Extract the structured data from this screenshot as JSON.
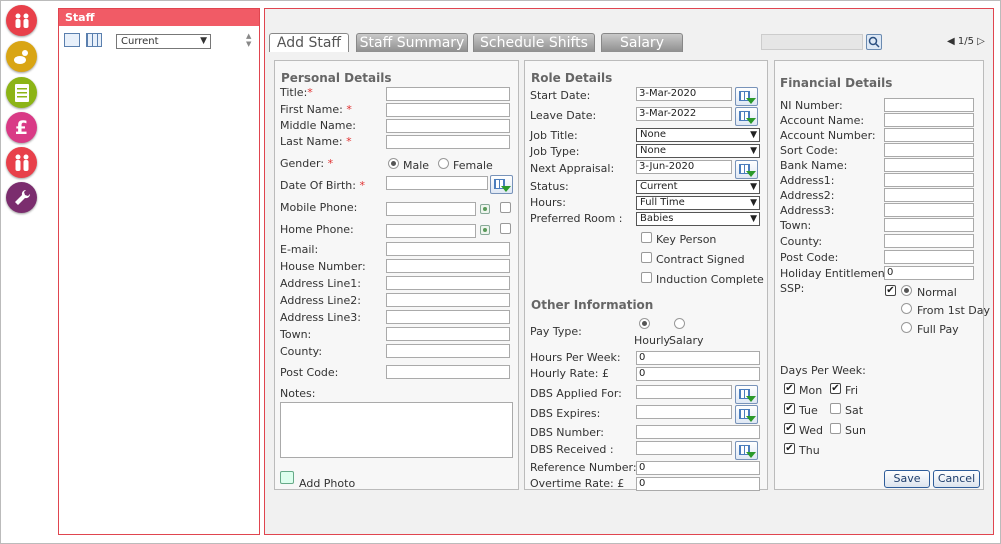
{
  "nav": {
    "icons": [
      "staff-group-icon",
      "children-icon",
      "register-icon",
      "finance-icon",
      "family-icon",
      "settings-icon"
    ]
  },
  "left_panel": {
    "title": "Staff",
    "filter": {
      "selected": "Current"
    }
  },
  "tabs": [
    {
      "label": "Add Staff"
    },
    {
      "label": "Staff Summary"
    },
    {
      "label": "Schedule Shifts"
    },
    {
      "label": "Salary"
    }
  ],
  "pager": {
    "text": "1/5"
  },
  "personal": {
    "heading": "Personal Details",
    "title_label": "Title:",
    "first_name_label": "First Name:",
    "middle_name_label": "Middle Name:",
    "last_name_label": "Last Name:",
    "gender_label": "Gender:",
    "male_label": "Male",
    "female_label": "Female",
    "dob_label": "Date Of Birth:",
    "mobile_label": "Mobile Phone:",
    "home_label": "Home Phone:",
    "email_label": "E-mail:",
    "house_label": "House Number:",
    "addr1_label": "Address Line1:",
    "addr2_label": "Address Line2:",
    "addr3_label": "Address Line3:",
    "town_label": "Town:",
    "county_label": "County:",
    "postcode_label": "Post Code:",
    "notes_label": "Notes:",
    "add_photo_label": "Add Photo",
    "required_mark": "*"
  },
  "role": {
    "heading": "Role Details",
    "start_label": "Start Date:",
    "start_value": "3-Mar-2020",
    "leave_label": "Leave Date:",
    "leave_value": "3-Mar-2022",
    "job_title_label": "Job Title:",
    "job_title_value": "None",
    "job_type_label": "Job Type:",
    "job_type_value": "None",
    "appraisal_label": "Next Appraisal:",
    "appraisal_value": "3-Jun-2020",
    "status_label": "Status:",
    "status_value": "Current",
    "hours_label": "Hours:",
    "hours_value": "Full Time",
    "room_label": "Preferred Room :",
    "room_value": "Babies",
    "key_person_label": "Key Person",
    "contract_label": "Contract Signed",
    "induction_label": "Induction Complete"
  },
  "other": {
    "heading": "Other Information",
    "pay_type_label": "Pay Type:",
    "hourly_label": "Hourly",
    "salary_label": "Salary",
    "hours_week_label": "Hours Per Week:",
    "hours_week_value": "0",
    "hourly_rate_label": "Hourly Rate: £",
    "hourly_rate_value": "0",
    "dbs_applied_label": "DBS Applied For:",
    "dbs_expires_label": "DBS Expires:",
    "dbs_number_label": "DBS Number:",
    "dbs_received_label": "DBS Received :",
    "reference_label": "Reference Number:",
    "reference_value": "0",
    "overtime_label": "Overtime Rate: £",
    "overtime_value": "0"
  },
  "financial": {
    "heading": "Financial Details",
    "ni_label": "NI Number:",
    "acc_name_label": "Account Name:",
    "acc_number_label": "Account Number:",
    "sort_label": "Sort Code:",
    "bank_label": "Bank Name:",
    "addr1_label": "Address1:",
    "addr2_label": "Address2:",
    "addr3_label": "Address3:",
    "town_label": "Town:",
    "county_label": "County:",
    "postcode_label": "Post Code:",
    "holiday_label": "Holiday Entitlement:",
    "holiday_value": "0",
    "ssp_label": "SSP:",
    "normal_label": "Normal",
    "from1st_label": "From 1st Day",
    "fullpay_label": "Full Pay",
    "days_label": "Days Per Week:",
    "mon": "Mon",
    "tue": "Tue",
    "wed": "Wed",
    "thu": "Thu",
    "fri": "Fri",
    "sat": "Sat",
    "sun": "Sun",
    "save_label": "Save",
    "cancel_label": "Cancel"
  },
  "colors": {
    "accent": "#f15b66",
    "border": "#e0454f"
  }
}
